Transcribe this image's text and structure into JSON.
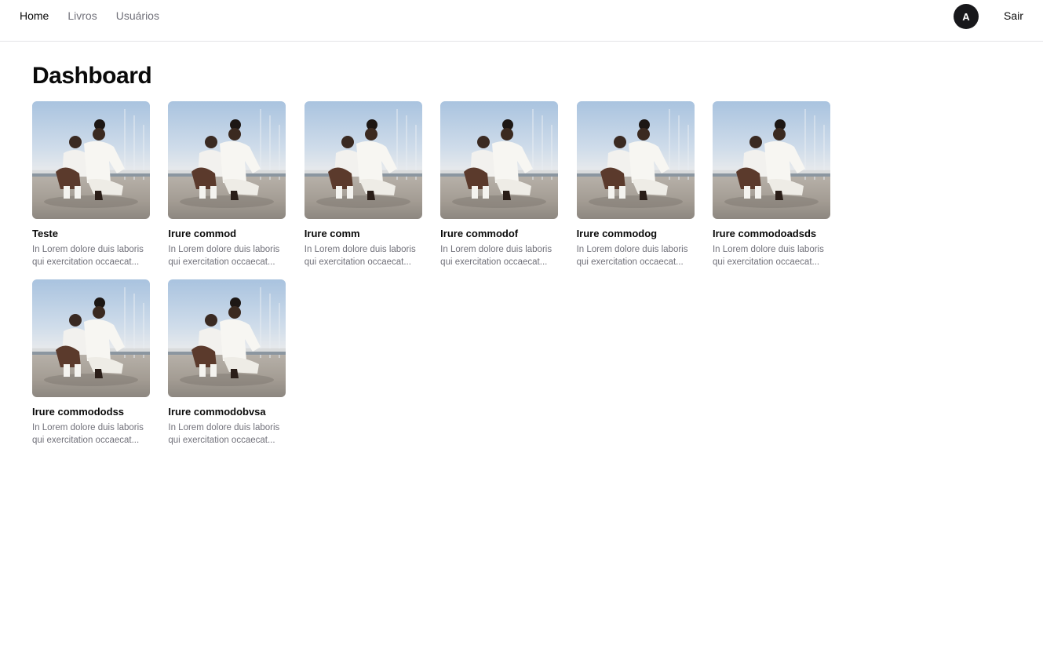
{
  "nav": {
    "items": [
      {
        "label": "Home",
        "active": true
      },
      {
        "label": "Livros",
        "active": false
      },
      {
        "label": "Usuários",
        "active": false
      }
    ]
  },
  "user": {
    "avatar_initial": "A",
    "logout_label": "Sair"
  },
  "page": {
    "title": "Dashboard"
  },
  "books": [
    {
      "title": "Teste",
      "description": "In Lorem dolore duis laboris qui exercitation occaecat..."
    },
    {
      "title": "Irure commod",
      "description": "In Lorem dolore duis laboris qui exercitation occaecat..."
    },
    {
      "title": "Irure comm",
      "description": "In Lorem dolore duis laboris qui exercitation occaecat..."
    },
    {
      "title": "Irure commodof",
      "description": "In Lorem dolore duis laboris qui exercitation occaecat..."
    },
    {
      "title": "Irure commodog",
      "description": "In Lorem dolore duis laboris qui exercitation occaecat..."
    },
    {
      "title": "Irure commodoadsds",
      "description": "In Lorem dolore duis laboris qui exercitation occaecat..."
    },
    {
      "title": "Irure commododss",
      "description": "In Lorem dolore duis laboris qui exercitation occaecat..."
    },
    {
      "title": "Irure commodobvsa",
      "description": "In Lorem dolore duis laboris qui exercitation occaecat..."
    }
  ]
}
